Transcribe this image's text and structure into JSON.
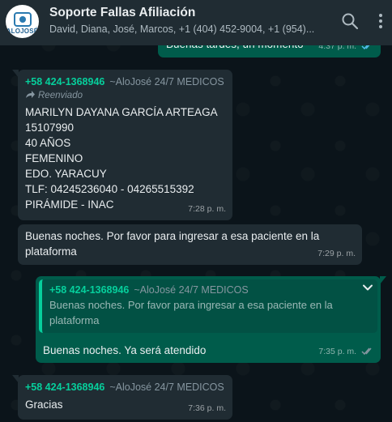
{
  "header": {
    "title": "Soporte Fallas Afiliación",
    "subtitle": "David, Diana, José, Marcos, +1 (404) 452-9004, +1 (954)...",
    "avatar_text": "ALOJOSÉ"
  },
  "messages": {
    "m0": {
      "text": "Buenas tardes, un momento",
      "time": "4:37 p. m."
    },
    "m1": {
      "sender_phone": "+58 424-1368946",
      "sender_name": "~AloJosé 24/7 MEDICOS",
      "forwarded": "Reenviado",
      "lines": [
        "MARILYN DAYANA GARCÍA ARTEAGA",
        "15107990",
        "40 AÑOS",
        "FEMENINO",
        "EDO. YARACUY",
        "TLF: 04245236040 - 04265515392",
        "PIRÁMIDE - INAC"
      ],
      "time": "7:28 p. m."
    },
    "m2": {
      "text": "Buenas noches. Por favor para ingresar a esa paciente en la plataforma",
      "time": "7:29 p. m."
    },
    "m3": {
      "quote_phone": "+58 424-1368946",
      "quote_name": "~AloJosé 24/7 MEDICOS",
      "quote_text": "Buenas noches. Por favor para ingresar a esa paciente en la plataforma",
      "text": "Buenas noches. Ya será atendido",
      "time": "7:35 p. m."
    },
    "m4": {
      "sender_phone": "+58 424-1368946",
      "sender_name": "~AloJosé 24/7 MEDICOS",
      "text": "Gracias",
      "time": "7:36 p. m."
    }
  },
  "colors": {
    "background": "#0b141a",
    "header": "#202c33",
    "incoming": "#202c33",
    "outgoing": "#005c4b",
    "accent": "#06cf9c",
    "read_check": "#53bdeb"
  },
  "icons": [
    "search-icon",
    "menu-icon",
    "forward-icon",
    "chevron-down-icon",
    "read-check-icon"
  ]
}
